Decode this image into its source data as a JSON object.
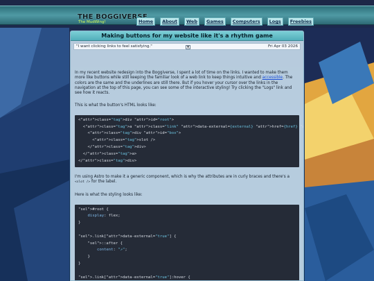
{
  "site": {
    "brand_title": "THE BOGGIVERSE",
    "brand_subtitle": "The MudWing!",
    "nav": [
      "Home",
      "About",
      "Web",
      "Games",
      "Computers",
      "Logs",
      "Freebies"
    ]
  },
  "post": {
    "title": "Making buttons for my website like it's a rhythm game",
    "quote": "\"I want clicking links to feel satisfying.\"",
    "date": "Fri Apr 03 2026",
    "toggle_glyph": "▼",
    "para1_before_link": "In my recent website redesign into the Boggiverse, I spent a lot of time on the links. I wanted to make them more like buttons while still keeping the familiar look of a web link to keep things intuitive and ",
    "para1_link": "accessible",
    "para1_after_link": ". The colors are the same and the underlines are still there. But if you hover your cursor over the links in the navigation at the top of this page, you can see some of the interactive styling! Try clicking the \"Logs\" link and see how it reacts.",
    "para2": "This is what the button's HTML looks like:",
    "para3_before_code": "I'm using Astro to make it a generic component, which is why the attributes are in curly braces and there's a ",
    "para3_code": "<slot />",
    "para3_after_code": " for the label.",
    "para4": "Here is what the styling looks like:",
    "html_code_lines": [
      "<div id=\"root\">",
      "  <a class=\"link\" data-external={external} href={href} target={target}>",
      "    <div id=\"box\">",
      "      <slot />",
      "    </div>",
      "  </a>",
      "</div>"
    ],
    "css_code_lines": [
      "#root {",
      "    display: flex;",
      "}",
      "",
      ".link[data-external=\"true\"] {",
      "    ::after {",
      "        content: \"↗\";",
      "    }",
      "}",
      "",
      ".link[data-external=\"true\"]:hover {"
    ]
  },
  "colors": {
    "nav_bar": "#4f9aa4",
    "panel_title": "#7ccfd6",
    "code_bg": "#252b37",
    "link": "#1b4fd6",
    "brand_subtitle": "#d8ff5a"
  }
}
